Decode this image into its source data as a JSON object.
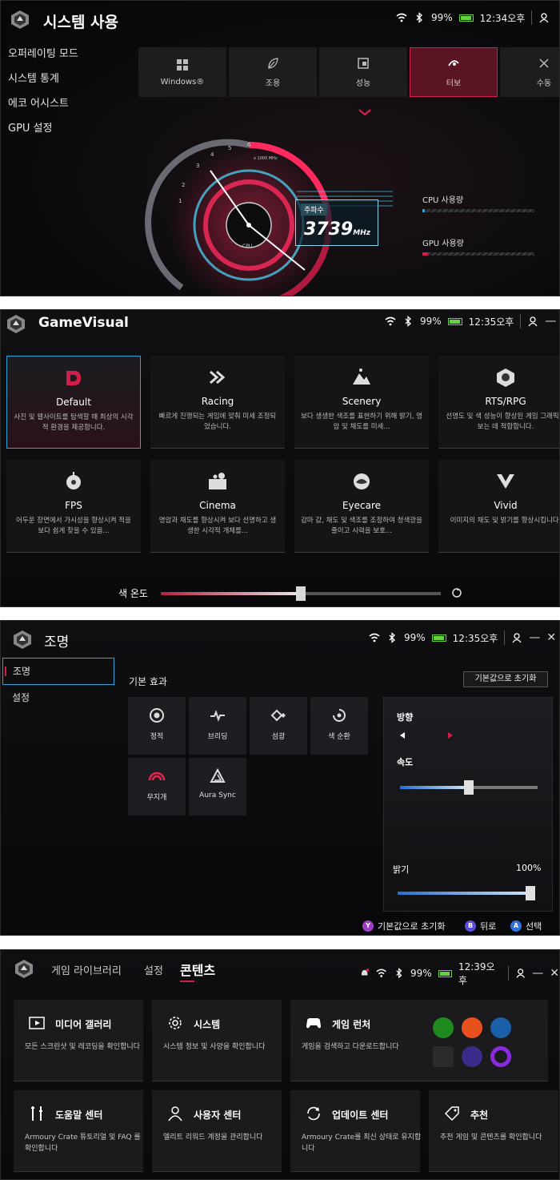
{
  "status": {
    "battery": "99%",
    "times": [
      "12:34오후",
      "12:35오후",
      "12:35오후",
      "12:39오후"
    ]
  },
  "system": {
    "title": "시스템 사용",
    "menu": [
      "오퍼레이팅 모드",
      "시스템 통계",
      "에코 어시스트",
      "GPU 설정"
    ],
    "modes": [
      {
        "label": "Windows®",
        "icon": "windows-icon"
      },
      {
        "label": "조용",
        "icon": "leaf-icon"
      },
      {
        "label": "성능",
        "icon": "performance-icon"
      },
      {
        "label": "터보",
        "icon": "turbo-icon",
        "active": true
      },
      {
        "label": "수동",
        "icon": "tools-icon"
      }
    ],
    "gauge_ticks": [
      "1",
      "2",
      "3",
      "4",
      "5",
      "6"
    ],
    "gauge_unit": "x 1000 MHz",
    "gauge_center": "CPU",
    "freq_label": "주파수",
    "freq_value": "3739",
    "freq_unit": "MHz",
    "cpu_usage_label": "CPU 사용량",
    "cpu_usage": 0.02,
    "gpu_usage_label": "GPU 사용량",
    "gpu_usage": 0.05,
    "accent": "#d11f4a"
  },
  "gamevisual": {
    "title": "GameVisual",
    "cards": [
      {
        "name": "Default",
        "desc": "사진 및 웹사이트를 탐색할 때 최상의 시각적 환경을 제공합니다.",
        "icon": "default-d-icon",
        "active": true
      },
      {
        "name": "Racing",
        "desc": "빠르게 진행되는 게임에 맞춰 미세 조정되었습니다.",
        "icon": "racing-icon"
      },
      {
        "name": "Scenery",
        "desc": "보다 생생한 색조를 표현하기 위해 밝기, 명암 및 채도를 미세...",
        "icon": "scenery-icon"
      },
      {
        "name": "RTS/RPG",
        "desc": "선명도 및 색 성능이 향상된 게임 그래픽을 보는 데 적합합니다.",
        "icon": "rts-icon"
      },
      {
        "name": "FPS",
        "desc": "어두운 장면에서 가시성을 향상시켜 적을 보다 쉽게 찾을 수 있음...",
        "icon": "fps-icon"
      },
      {
        "name": "Cinema",
        "desc": "명암과 채도를 향상시켜 보다 선명하고 생생한 시각적 개체를...",
        "icon": "cinema-icon"
      },
      {
        "name": "Eyecare",
        "desc": "감마 값, 채도 및 색조를 조정하여 청색광을 줄이고 시력을 보호...",
        "icon": "eyecare-icon"
      },
      {
        "name": "Vivid",
        "desc": "이미지의 채도 및 밝기를 향상시킵니다.",
        "icon": "vivid-icon"
      }
    ],
    "color_temp_label": "색 온도",
    "color_temp": 0.5
  },
  "lighting": {
    "title": "조명",
    "side": [
      "조명",
      "설정"
    ],
    "section_title": "기본 효과",
    "reset_label": "기본값으로 초기화",
    "effects": [
      {
        "label": "정적",
        "icon": "static-icon"
      },
      {
        "label": "브리딩",
        "icon": "breathing-icon"
      },
      {
        "label": "섬광",
        "icon": "strobe-icon"
      },
      {
        "label": "색 순환",
        "icon": "color-cycle-icon"
      },
      {
        "label": "무지개",
        "icon": "rainbow-icon"
      },
      {
        "label": "Aura Sync",
        "icon": "aura-sync-icon"
      }
    ],
    "direction_label": "방향",
    "speed_label": "속도",
    "speed": 0.5,
    "brightness_label": "밝기",
    "brightness_value": "100%",
    "brightness": 1.0,
    "hints": [
      {
        "key": "Y",
        "label": "기본값으로 초기화",
        "color": "#9b3fc4"
      },
      {
        "key": "B",
        "label": "뒤로",
        "color": "#5a4fd8"
      },
      {
        "key": "A",
        "label": "선택",
        "color": "#2f6fd8"
      }
    ]
  },
  "content": {
    "tabs": [
      "게임 라이브러리",
      "설정",
      "콘텐츠"
    ],
    "cards": [
      {
        "title": "미디어 갤러리",
        "desc": "모든 스크린샷 및 레코딩을 확인합니다",
        "icon": "media-gallery-icon"
      },
      {
        "title": "시스템",
        "desc": "시스템 정보 및 사양을 확인합니다",
        "icon": "gear-icon"
      },
      {
        "title": "게임 런처",
        "desc": "게임을 검색하고 다운로드합니다",
        "icon": "gamepad-icon"
      },
      {
        "title": "도움말 센터",
        "desc": "Armoury Crate 튜토리얼 및 FAQ 를 확인합니다",
        "icon": "help-tools-icon"
      },
      {
        "title": "사용자 센터",
        "desc": "엘리트 리워드 계정을 관리합니다",
        "icon": "user-icon"
      },
      {
        "title": "업데이트 센터",
        "desc": "Armoury Crate를 최신 상태로 유지합니다",
        "icon": "refresh-icon"
      },
      {
        "title": "추천",
        "desc": "추천 게임 및 콘텐츠를 확인합니다",
        "icon": "tag-icon"
      }
    ],
    "launchers": [
      {
        "name": "xbox-icon",
        "color": "#1f8a1f"
      },
      {
        "name": "ea-icon",
        "color": "#e8501e"
      },
      {
        "name": "steam-icon",
        "color": "#1b5fa8"
      },
      {
        "name": "epic-icon",
        "color": "#2b2b2b"
      },
      {
        "name": "ubisoft-icon",
        "color": "#3a2c8a"
      },
      {
        "name": "gog-icon",
        "color": "#8a2be2"
      }
    ]
  }
}
